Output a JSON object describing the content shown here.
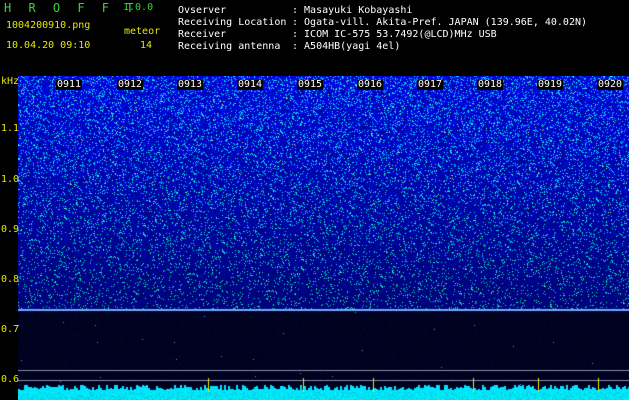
{
  "app": {
    "logo": "H R O F F T",
    "version": "1.0.0"
  },
  "file": {
    "name": "1004200910.png",
    "datetime": "10.04.20 09:10"
  },
  "meteor": {
    "label": "meteor",
    "count": "14"
  },
  "info": [
    {
      "label": "Ovserver",
      "value": ": Masayuki Kobayashi"
    },
    {
      "label": "Receiving Location",
      "value": ": Ogata-vill. Akita-Pref. JAPAN (139.96E, 40.02N)"
    },
    {
      "label": "Receiver",
      "value": ": ICOM IC-575 53.7492(@LCD)MHz USB"
    },
    {
      "label": "Receiving antenna",
      "value": ": A504HB(yagi 4el)"
    }
  ],
  "axis": {
    "unit": "kHz",
    "y_ticks": [
      "1.1",
      "1.0",
      "0.9",
      "0.8",
      "0.7",
      "0.6"
    ],
    "time_ticks": [
      "0911",
      "0912",
      "0913",
      "0914",
      "0915",
      "0916",
      "0917",
      "0918",
      "0919",
      "0920"
    ]
  },
  "colors": {
    "axis_text": "#e8e800",
    "logo": "#3cd23c",
    "signal_line": "#7fb0ff",
    "noise_floor": "#00e5ff"
  }
}
